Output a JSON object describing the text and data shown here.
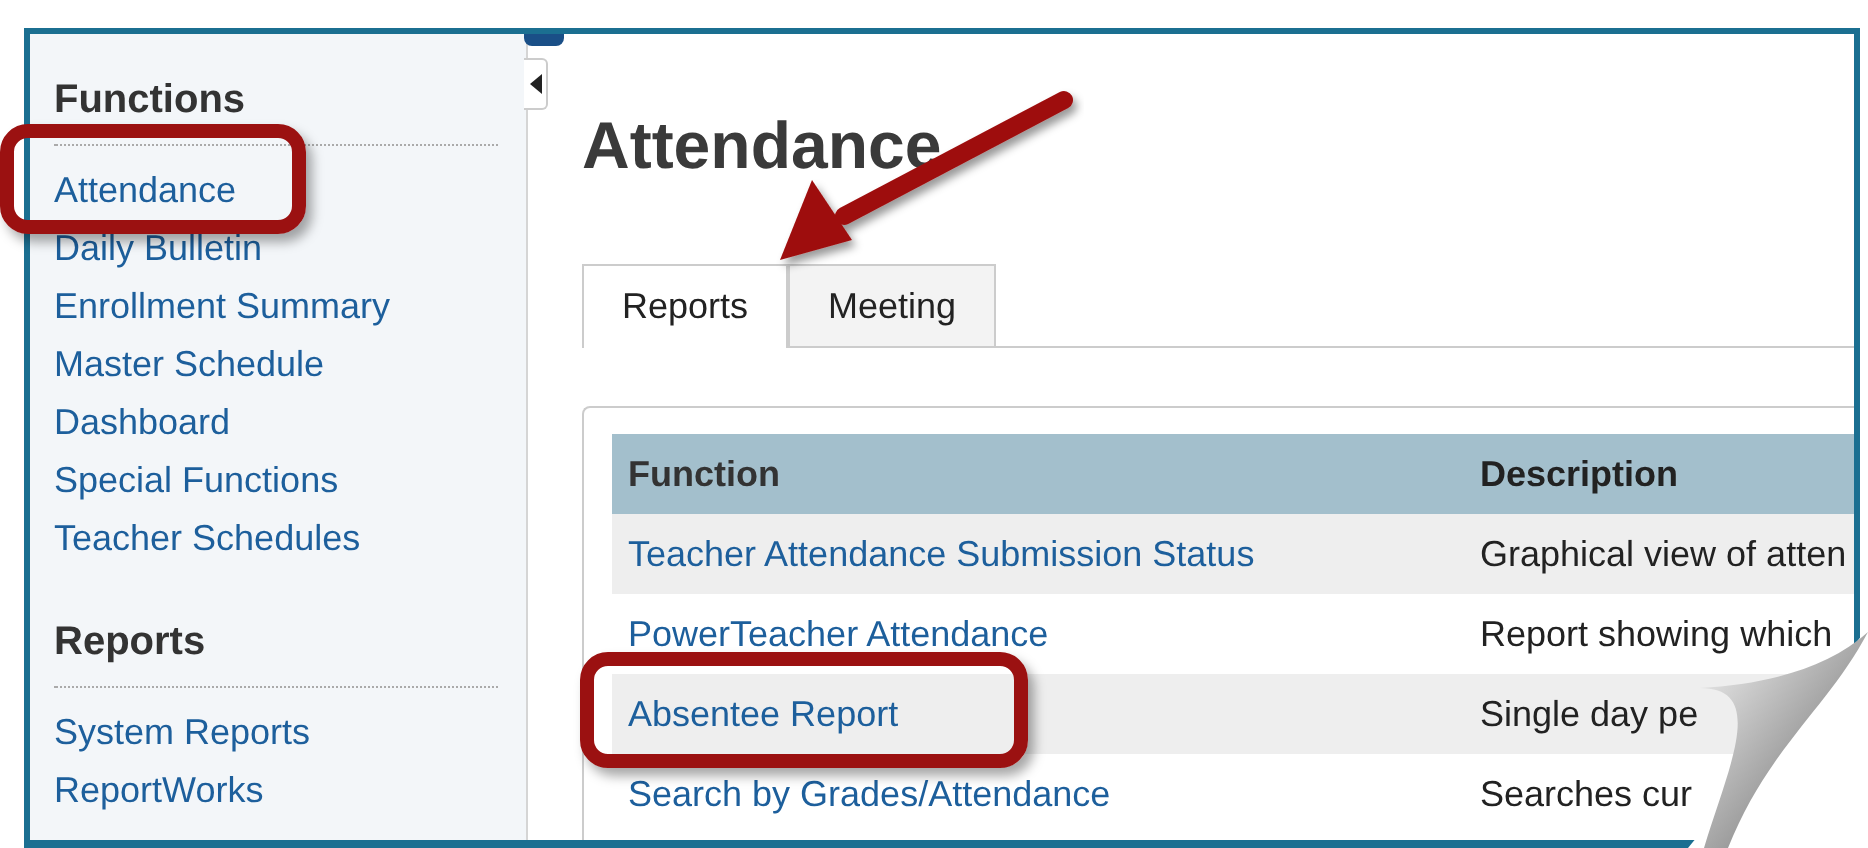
{
  "sidebar": {
    "sections": [
      {
        "heading": "Functions",
        "items": [
          {
            "label": "Attendance"
          },
          {
            "label": "Daily Bulletin"
          },
          {
            "label": "Enrollment Summary"
          },
          {
            "label": "Master Schedule"
          },
          {
            "label": "Dashboard"
          },
          {
            "label": "Special Functions"
          },
          {
            "label": "Teacher Schedules"
          }
        ]
      },
      {
        "heading": "Reports",
        "items": [
          {
            "label": "System Reports"
          },
          {
            "label": "ReportWorks"
          }
        ]
      }
    ]
  },
  "page": {
    "title": "Attendance"
  },
  "tabs": [
    {
      "label": "Reports",
      "selected": true
    },
    {
      "label": "Meeting",
      "selected": false
    }
  ],
  "table": {
    "columns": [
      "Function",
      "Description"
    ],
    "rows": [
      {
        "function": "Teacher Attendance Submission Status",
        "description": "Graphical view of atten"
      },
      {
        "function": "PowerTeacher Attendance",
        "description": "Report showing which"
      },
      {
        "function": "Absentee Report",
        "description": "Single day pe"
      },
      {
        "function": "Search by Grades/Attendance",
        "description": "Searches cur"
      }
    ]
  }
}
